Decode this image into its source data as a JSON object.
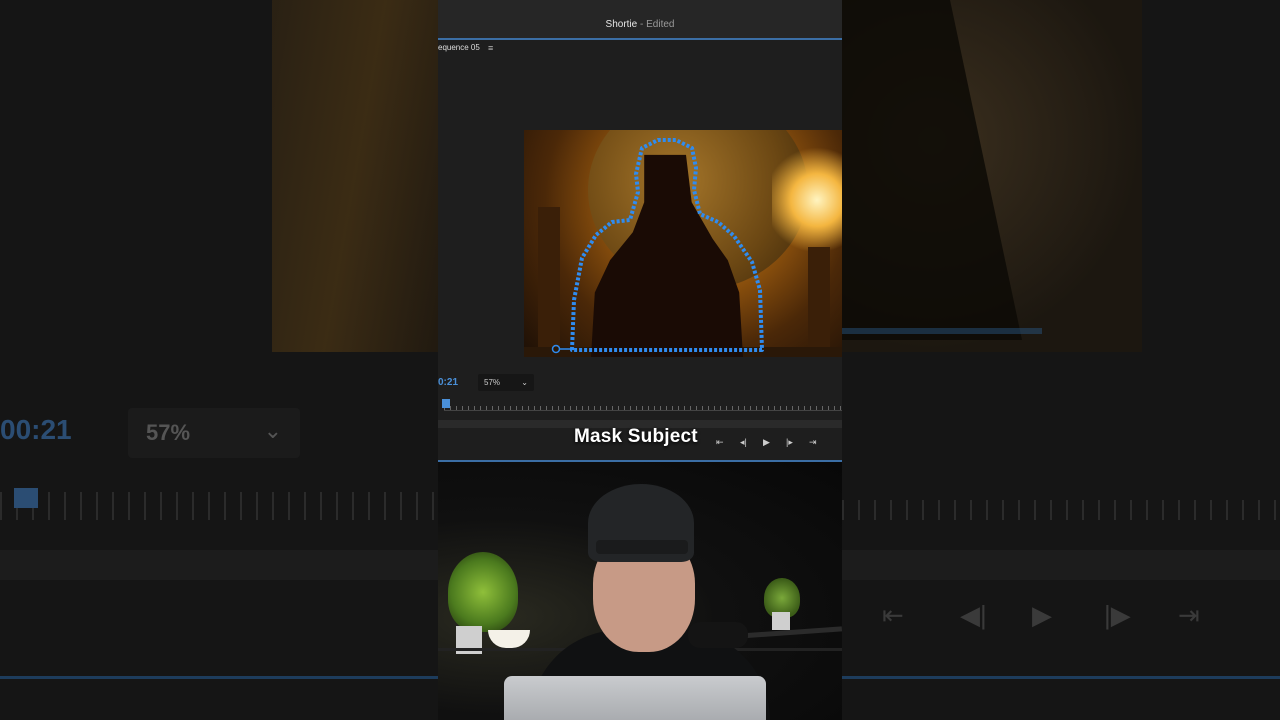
{
  "app": {
    "title": "Shortie",
    "status": "Edited"
  },
  "sequence": {
    "name": "equence 05",
    "menu_icon": "hamburger-menu-icon"
  },
  "viewer": {
    "timecode": "00:21",
    "timecode_visible": "0:21",
    "zoom": "57%",
    "zoom_icon": "chevron-down-icon"
  },
  "caption": "Mask Subject",
  "transport": {
    "go_to_in": "go-to-in-icon",
    "step_back": "step-back-icon",
    "play": "play-icon",
    "step_forward": "step-forward-icon",
    "go_to_out": "go-to-out-icon"
  },
  "background": {
    "timecode": "00:21",
    "zoom": "57%"
  },
  "colors": {
    "accent": "#3b6ea5",
    "mask": "#2f8cf0",
    "timecode": "#4a90d9"
  }
}
